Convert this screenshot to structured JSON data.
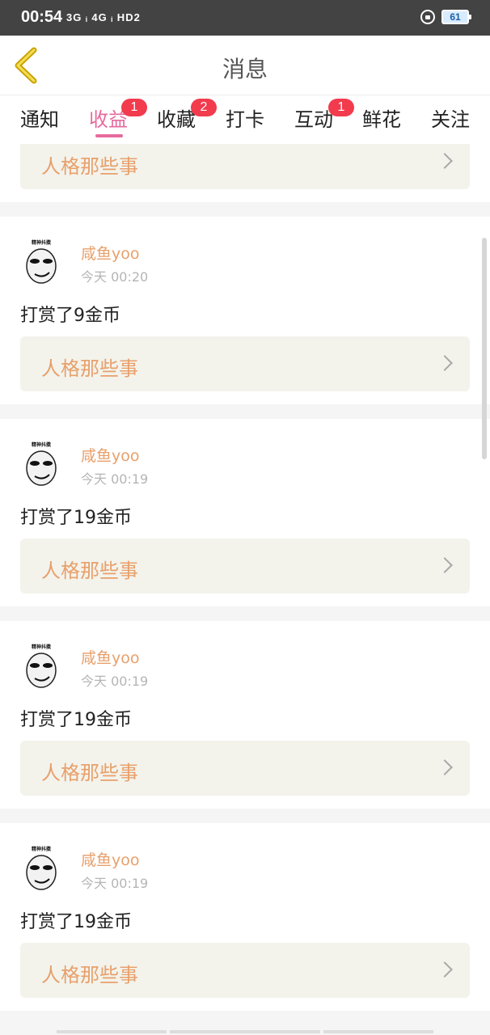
{
  "status_bar": {
    "time": "00:54",
    "network": "3G ᵢ 4G ᵢ HD2",
    "battery": "61"
  },
  "header": {
    "title": "消息"
  },
  "tabs": [
    {
      "label": "通知",
      "badge": null
    },
    {
      "label": "收益",
      "badge": "1",
      "active": true
    },
    {
      "label": "收藏",
      "badge": "2"
    },
    {
      "label": "打卡",
      "badge": null
    },
    {
      "label": "互动",
      "badge": "1"
    },
    {
      "label": "鲜花",
      "badge": null
    },
    {
      "label": "关注",
      "badge": null
    }
  ],
  "partial_card": {
    "novel_title": "人格那些事"
  },
  "cards": [
    {
      "username": "咸鱼yoo",
      "time": "今天 00:20",
      "message": "打赏了9金币",
      "novel_title": "人格那些事"
    },
    {
      "username": "咸鱼yoo",
      "time": "今天 00:19",
      "message": "打赏了19金币",
      "novel_title": "人格那些事"
    },
    {
      "username": "咸鱼yoo",
      "time": "今天 00:19",
      "message": "打赏了19金币",
      "novel_title": "人格那些事"
    },
    {
      "username": "咸鱼yoo",
      "time": "今天 00:19",
      "message": "打赏了19金币",
      "novel_title": "人格那些事"
    }
  ],
  "avatar_caption": "精神抖擞",
  "colors": {
    "accent": "#e66a9d",
    "username": "#e8a06b",
    "badge": "#f23b4d",
    "back_icon": "#c9a200"
  }
}
